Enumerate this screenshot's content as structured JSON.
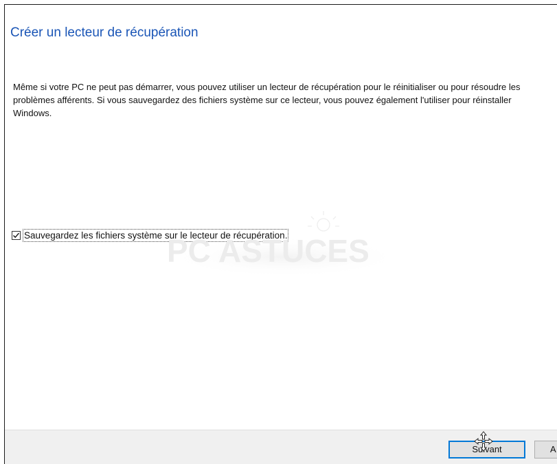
{
  "dialog": {
    "title": "Créer un lecteur de récupération",
    "description": "Même si votre PC ne peut pas démarrer, vous pouvez utiliser un lecteur de récupération pour le réinitialiser ou pour résoudre les problèmes afférents. Si vous sauvegardez des fichiers système sur ce lecteur, vous pouvez également l'utiliser pour réinstaller Windows.",
    "checkbox": {
      "label": "Sauvegardez les fichiers système sur le lecteur de récupération.",
      "checked": true
    }
  },
  "watermark": {
    "text": "PC ASTUCES"
  },
  "footer": {
    "next_label": "Suivant",
    "cancel_label": "A"
  },
  "colors": {
    "title": "#1a55b6",
    "accent": "#0078d7",
    "footer_bg": "#f0f0f0"
  },
  "icons": {
    "checkbox": "checkmark-icon",
    "cursor": "move-cursor-icon"
  }
}
